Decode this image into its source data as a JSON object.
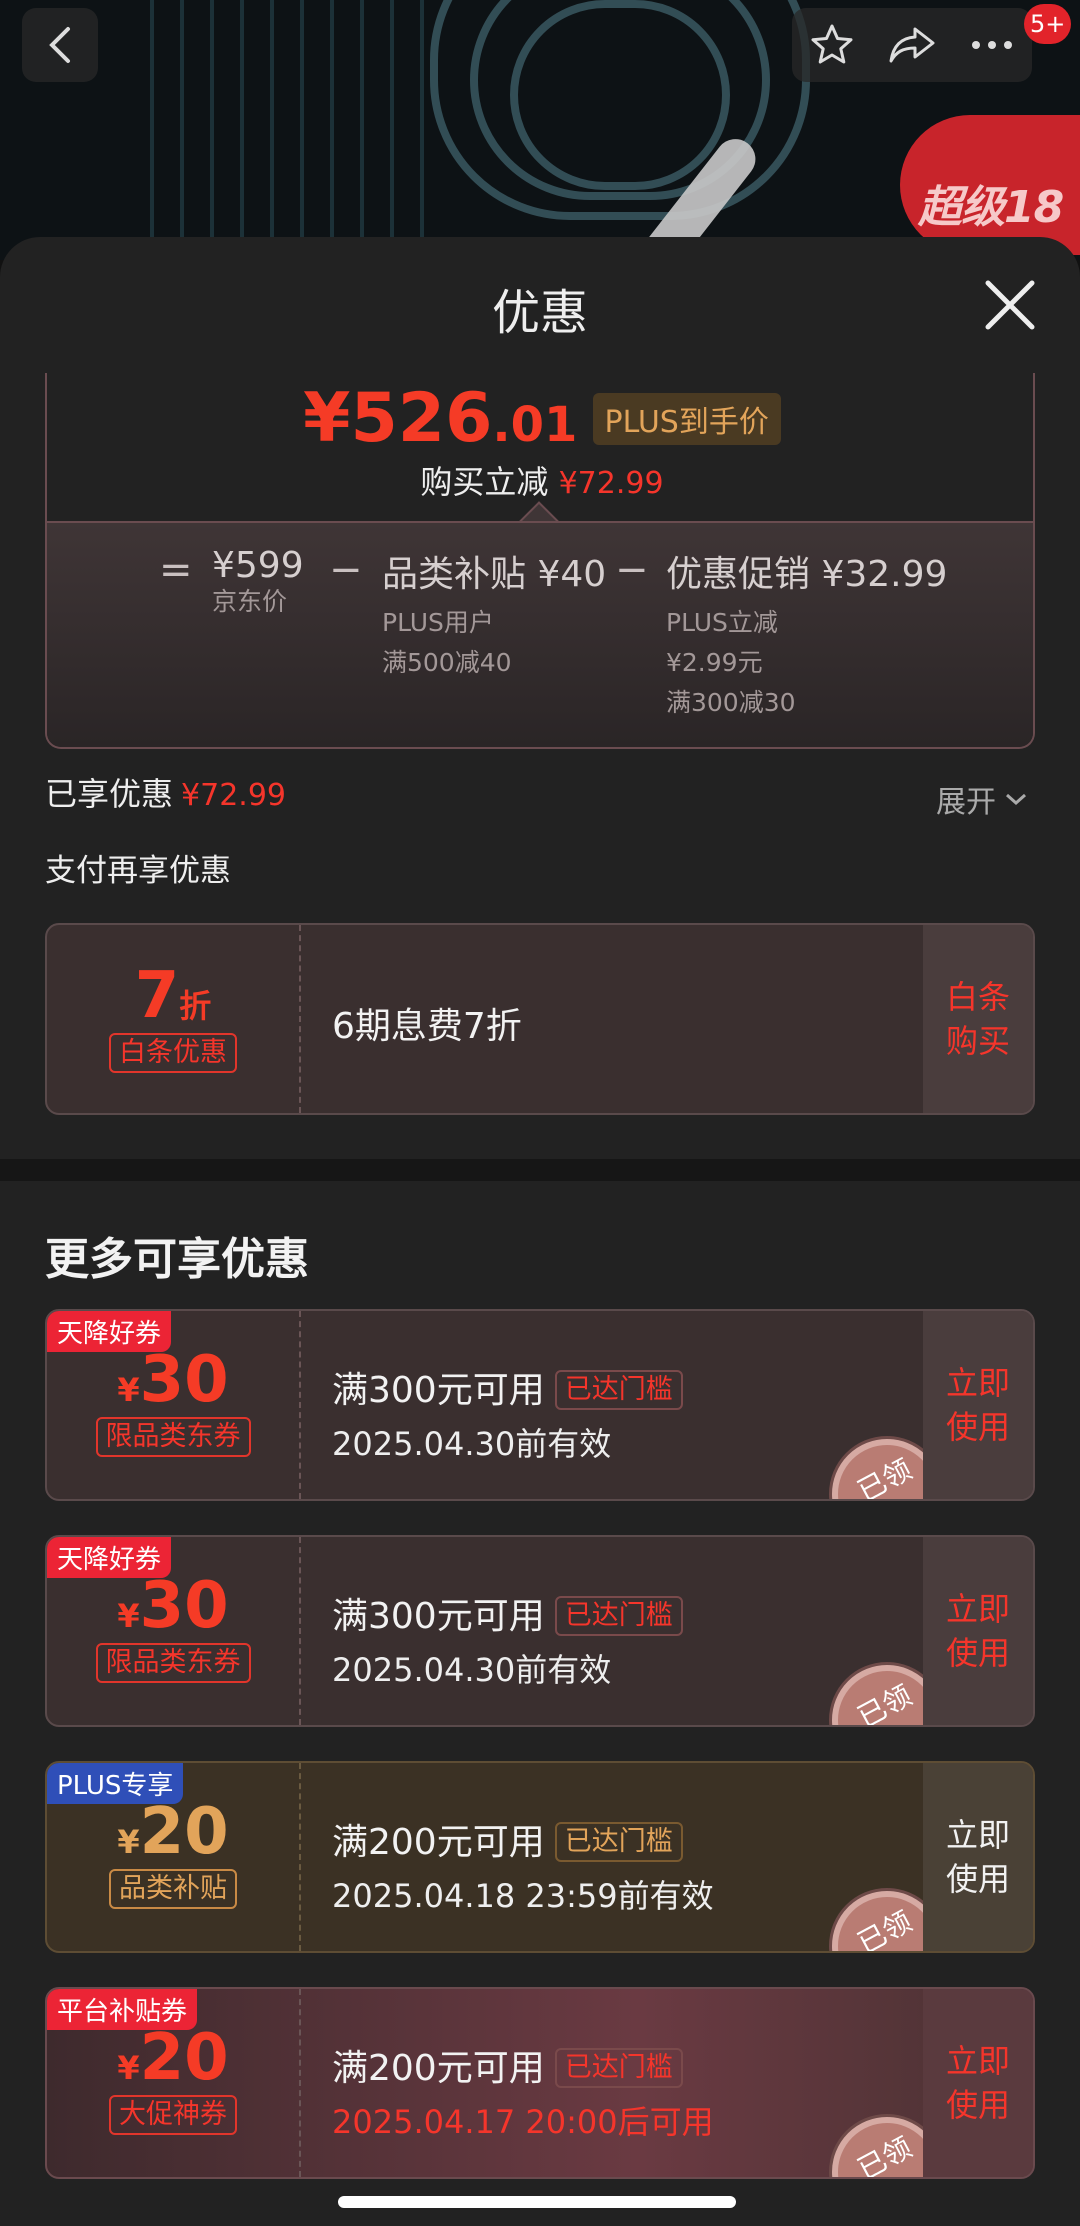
{
  "topbar": {
    "icons": [
      "back-icon",
      "star-icon",
      "share-icon",
      "more-icon"
    ],
    "message_count": "5+",
    "promo_badge": "超级18"
  },
  "sheet": {
    "title": "优惠",
    "final_price_int": "¥526",
    "final_price_dec": ".01",
    "plus_tag": "PLUS到手价",
    "reduce_label": "购买立减",
    "reduce_amount": "¥72.99",
    "breakdown": {
      "eq": "=",
      "jd_price": "¥599",
      "jd_price_label": "京东价",
      "minus1": "−",
      "subsidy": "品类补贴 ¥40",
      "subsidy_lines": [
        "PLUS用户",
        "满500减40"
      ],
      "minus2": "−",
      "promo": "优惠促销 ¥32.99",
      "promo_lines": [
        "PLUS立减",
        "¥2.99元",
        "满300减30"
      ]
    },
    "enjoyed_label": "已享优惠",
    "enjoyed_amount": "¥72.99",
    "expand_label": "展开",
    "pay_title": "支付再享优惠",
    "pay_card": {
      "discount_num": "7",
      "discount_unit": "折",
      "tag": "白条优惠",
      "desc": "6期息费7折",
      "action": [
        "白条",
        "购买"
      ]
    },
    "more_title": "更多可享优惠",
    "coupons": [
      {
        "badge": "天降好券",
        "currency": "¥",
        "amount": "30",
        "tag": "限品类东券",
        "condition": "满300元可用",
        "threshold": "已达门槛",
        "validity": "2025.04.30前有效",
        "action": [
          "立即",
          "使用"
        ],
        "stamp": "已领"
      },
      {
        "badge": "天降好券",
        "currency": "¥",
        "amount": "30",
        "tag": "限品类东券",
        "condition": "满300元可用",
        "threshold": "已达门槛",
        "validity": "2025.04.30前有效",
        "action": [
          "立即",
          "使用"
        ],
        "stamp": "已领"
      },
      {
        "badge": "PLUS专享",
        "currency": "¥",
        "amount": "20",
        "tag": "品类补贴",
        "condition": "满200元可用",
        "threshold": "已达门槛",
        "validity": "2025.04.18 23:59前有效",
        "action": [
          "立即",
          "使用"
        ],
        "stamp": "已领"
      },
      {
        "badge": "平台补贴券",
        "currency": "¥",
        "amount": "20",
        "tag": "大促神券",
        "condition": "满200元可用",
        "threshold": "已达门槛",
        "validity": "2025.04.17 20:00后可用",
        "action": [
          "立即",
          "使用"
        ],
        "stamp": "已领"
      }
    ]
  },
  "colors": {
    "price_red": "#f53b26",
    "plus_gold": "#e2a45a",
    "sheet_bg": "#222222",
    "plus_badge_blue": "#2f4fb8"
  }
}
